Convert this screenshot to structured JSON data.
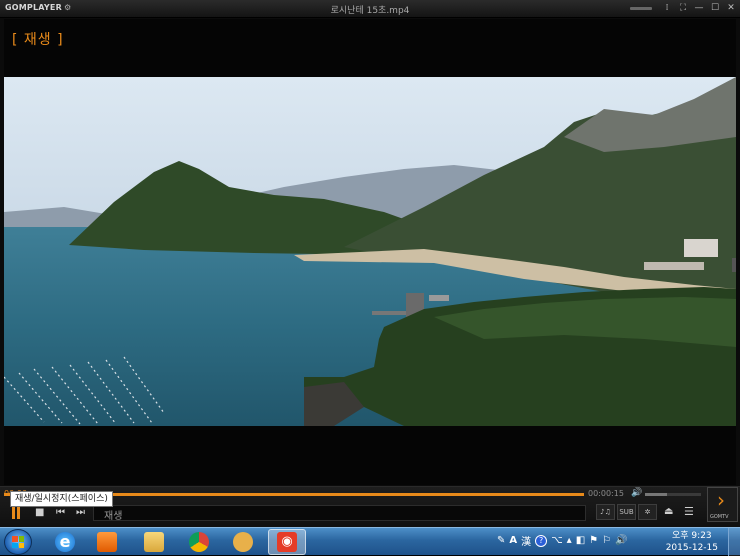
{
  "app": {
    "logo": "GOMPLAYER",
    "title": "로시난테 15초.mp4"
  },
  "osd": {
    "status": "[ 재생 ]"
  },
  "controls": {
    "elapsed": "00:00",
    "duration": "00:00:15",
    "seek_position": 1.0,
    "volume": 0.4,
    "status_text": "재생",
    "sub_label": "SUB",
    "gomtv_label": "GOMTV",
    "tooltip": "재생/일시정지(스페이스)"
  },
  "colors": {
    "accent": "#e88a1a",
    "taskbar": "#2b66a0"
  },
  "taskbar": {
    "apps": [
      {
        "name": "internet-explorer-icon"
      },
      {
        "name": "media-player-icon"
      },
      {
        "name": "file-explorer-icon"
      },
      {
        "name": "chrome-icon"
      },
      {
        "name": "mascot-app-icon"
      },
      {
        "name": "gom-player-icon"
      }
    ],
    "tray_lang": "A",
    "tray_hanja": "漢",
    "clock_time": "오후 9:23",
    "clock_date": "2015-12-15"
  }
}
